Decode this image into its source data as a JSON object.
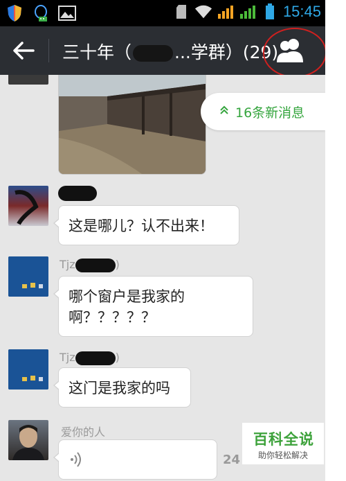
{
  "statusbar": {
    "icons": [
      "shield-icon",
      "qq-icon",
      "gallery-icon",
      "sdcard-icon",
      "wifi-icon",
      "signal-3g-icon",
      "signal-bars-icon",
      "battery-icon"
    ],
    "time": "15:45"
  },
  "header": {
    "title_prefix": "三十年（",
    "title_suffix": "...学群）(29)",
    "back_icon": "back-arrow-icon",
    "members_icon": "group-members-icon",
    "annotation_color": "#d0201f"
  },
  "new_messages": {
    "label": "16条新消息",
    "icon": "double-chevron-up-icon"
  },
  "messages": [
    {
      "sender": "",
      "text": "",
      "type": "image"
    },
    {
      "sender": "",
      "text": "这是哪儿？认不出来！",
      "type": "text"
    },
    {
      "sender": "Tjz",
      "sender_tail": ")",
      "text": "哪个窗户是我家的啊？？？？？",
      "line1": "哪个窗户是我家的",
      "line2": "啊？？？？？",
      "type": "text"
    },
    {
      "sender": "Tjz",
      "sender_tail": ")",
      "text": "这门是我家的吗",
      "type": "text"
    },
    {
      "sender": "爱你的人",
      "text": "",
      "type": "voice",
      "duration": "24"
    }
  ],
  "watermark": {
    "title": "百科全说",
    "subtitle": "助你轻松解决"
  },
  "colors": {
    "accent_green": "#35a53e",
    "topbar": "#2b2e33",
    "clock_blue": "#2fa8e6"
  }
}
